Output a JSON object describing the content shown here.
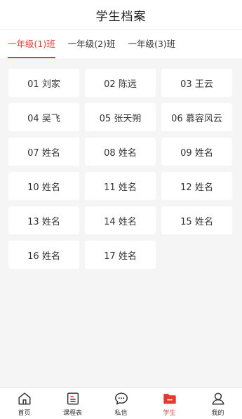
{
  "header": {
    "title": "学生档案"
  },
  "tabs": [
    {
      "label": "一年级(1)班"
    },
    {
      "label": "一年级(2)班"
    },
    {
      "label": "一年级(3)班"
    }
  ],
  "active_tab": 0,
  "students": [
    {
      "label": "01 刘家"
    },
    {
      "label": "02 陈远"
    },
    {
      "label": "03 王云"
    },
    {
      "label": "04 吴飞"
    },
    {
      "label": "05 张天朔"
    },
    {
      "label": "06 慕容风云"
    },
    {
      "label": "07 姓名"
    },
    {
      "label": "08 姓名"
    },
    {
      "label": "09 姓名"
    },
    {
      "label": "10 姓名"
    },
    {
      "label": "11 姓名"
    },
    {
      "label": "12 姓名"
    },
    {
      "label": "13 姓名"
    },
    {
      "label": "14 姓名"
    },
    {
      "label": "15 姓名"
    },
    {
      "label": "16 姓名"
    },
    {
      "label": "17 姓名"
    }
  ],
  "tabbar": [
    {
      "label": "首页",
      "icon": "home-icon"
    },
    {
      "label": "课程表",
      "icon": "schedule-icon"
    },
    {
      "label": "私信",
      "icon": "message-icon"
    },
    {
      "label": "学生",
      "icon": "folder-icon"
    },
    {
      "label": "我的",
      "icon": "user-icon"
    }
  ],
  "active_tabbar": 3,
  "colors": {
    "accent": "#e53a2f",
    "background": "#f5f5f5",
    "text": "#333333"
  }
}
